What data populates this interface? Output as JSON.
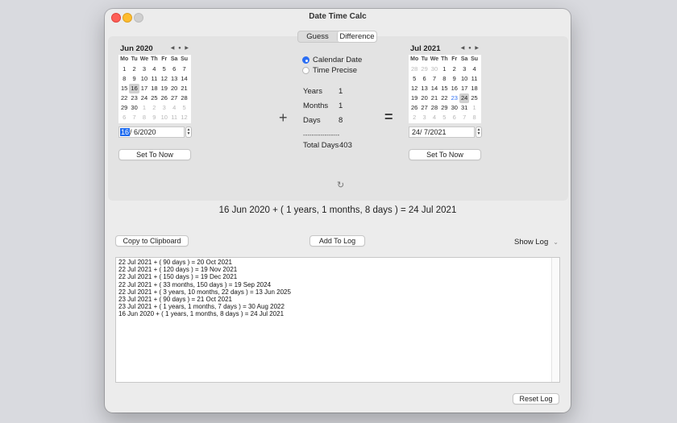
{
  "window": {
    "title": "Date Time Calc"
  },
  "tabs": [
    {
      "label": "Guess",
      "selected": false
    },
    {
      "label": "Difference",
      "selected": true
    }
  ],
  "dow": [
    "Mo",
    "Tu",
    "We",
    "Th",
    "Fr",
    "Sa",
    "Su"
  ],
  "nav_icons": [
    "chevron-left-icon",
    "dot-icon",
    "chevron-right-icon"
  ],
  "left_calendar": {
    "month": "Jun 2020",
    "weeks": [
      [
        "1",
        "2",
        "3",
        "4",
        "5",
        "6",
        "7"
      ],
      [
        "8",
        "9",
        "10",
        "11",
        "12",
        "13",
        "14"
      ],
      [
        "15",
        "16",
        "17",
        "18",
        "19",
        "20",
        "21"
      ],
      [
        "22",
        "23",
        "24",
        "25",
        "26",
        "27",
        "28"
      ],
      [
        "29",
        "30",
        "1",
        "2",
        "3",
        "4",
        "5"
      ],
      [
        "6",
        "7",
        "8",
        "9",
        "10",
        "11",
        "12"
      ]
    ],
    "selected_day": "16",
    "date_field_day": "16",
    "date_field_rest": "/  6/2020",
    "set_now_label": "Set To Now"
  },
  "right_calendar": {
    "month": "Jul 2021",
    "weeks": [
      [
        "28",
        "29",
        "30",
        "1",
        "2",
        "3",
        "4"
      ],
      [
        "5",
        "6",
        "7",
        "8",
        "9",
        "10",
        "11"
      ],
      [
        "12",
        "13",
        "14",
        "15",
        "16",
        "17",
        "18"
      ],
      [
        "19",
        "20",
        "21",
        "22",
        "23",
        "24",
        "25"
      ],
      [
        "26",
        "27",
        "28",
        "29",
        "30",
        "31",
        "1"
      ],
      [
        "2",
        "3",
        "4",
        "5",
        "6",
        "7",
        "8"
      ]
    ],
    "selected_day": "24",
    "today_day": "23",
    "date_field": "24/  7/2021",
    "set_now_label": "Set To Now"
  },
  "mode": {
    "options": [
      {
        "label": "Calendar Date",
        "selected": true
      },
      {
        "label": "Time Precise",
        "selected": false
      }
    ]
  },
  "difference": {
    "years_label": "Years",
    "years_value": "1",
    "months_label": "Months",
    "months_value": "1",
    "days_label": "Days",
    "days_value": "8",
    "separator": "-----------------",
    "total_label": "Total Days",
    "total_value": "403"
  },
  "operators": {
    "plus": "+",
    "equals": "="
  },
  "result_text": "16 Jun 2020 + ( 1 years, 1 months, 8 days ) = 24 Jul 2021",
  "actions": {
    "copy_label": "Copy to Clipboard",
    "add_label": "Add To Log",
    "show_log_label": "Show Log",
    "reset_label": "Reset Log"
  },
  "log": [
    "22 Jul 2021 + ( 90 days ) = 20 Oct 2021",
    "22 Jul 2021 + ( 120 days ) = 19 Nov 2021",
    "22 Jul 2021 + ( 150 days ) = 19 Dec 2021",
    "22 Jul 2021 + ( 33 months, 150 days ) = 19 Sep 2024",
    "22 Jul 2021 + ( 3 years, 10 months, 22 days ) = 13 Jun 2025",
    "23 Jul 2021 + ( 90 days ) = 21 Oct 2021",
    "23 Jul 2021 + ( 1 years, 1 months, 7 days ) = 30 Aug 2022",
    "16 Jun 2020 + ( 1 years, 1 months, 8 days ) = 24 Jul 2021"
  ]
}
